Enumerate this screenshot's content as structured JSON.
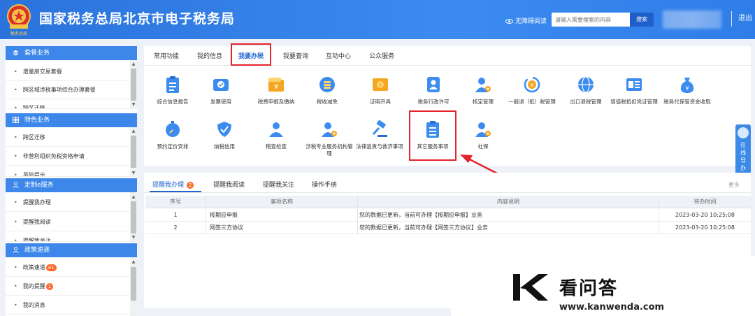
{
  "colors": {
    "header_blue": "#2f7de8",
    "accent": "#1e63d0",
    "highlight_red": "#e3242b",
    "badge_orange": "#ff6a2c"
  },
  "header": {
    "emblem_caption": "税务总局",
    "title": "国家税务总局北京市电子税务局",
    "accessibility_label": "无障碍阅读",
    "search_placeholder": "请输入需要搜索的内容",
    "search_button": "搜索",
    "logout_label": "退出"
  },
  "sidebar": {
    "groups": [
      {
        "title": "套餐业务",
        "icon": "layers-icon",
        "items": [
          "增量房交易套餐",
          "跨区域涉税事项综合办理套餐",
          "跨区迁移"
        ]
      },
      {
        "title": "特色业务",
        "icon": "grid-icon",
        "items": [
          "跨区迁移",
          "非营利组织免税资格申请",
          "风险提示"
        ]
      },
      {
        "title": "定制e服务",
        "icon": "user-icon",
        "items": [
          "提醒我办理",
          "提醒我阅读",
          "提醒我关注"
        ]
      },
      {
        "title": "政策速递",
        "icon": "user-icon",
        "items": [
          {
            "label": "政策速递",
            "badge": "41"
          },
          {
            "label": "我的提醒",
            "badge": "1"
          },
          {
            "label": "我的消息",
            "badge": ""
          }
        ]
      }
    ]
  },
  "main": {
    "tabs": [
      "常用功能",
      "我的信息",
      "我要办税",
      "我要查询",
      "互动中心",
      "公众服务"
    ],
    "active_tab": "我要办税",
    "services_row1": [
      {
        "label": "综合信息报告",
        "icon": "clipboard-icon"
      },
      {
        "label": "发票使用",
        "icon": "ticket-icon"
      },
      {
        "label": "税费申报及缴纳",
        "icon": "wallet-icon"
      },
      {
        "label": "税收减免",
        "icon": "coin-stack-icon"
      },
      {
        "label": "证明开具",
        "icon": "certificate-icon"
      },
      {
        "label": "税务行政许可",
        "icon": "id-card-icon"
      },
      {
        "label": "核定管理",
        "icon": "person-gear-icon"
      },
      {
        "label": "一般退（抵）税管理",
        "icon": "refund-cycle-icon"
      },
      {
        "label": "出口退税管理",
        "icon": "globe-icon"
      },
      {
        "label": "增值税抵扣凭证管理",
        "icon": "invoice-icon"
      },
      {
        "label": "税务代保管资金收取",
        "icon": "money-bag-icon"
      }
    ],
    "services_row2": [
      {
        "label": "预约定价安排",
        "icon": "stopwatch-icon"
      },
      {
        "label": "纳税信用",
        "icon": "shield-check-icon"
      },
      {
        "label": "稽查检查",
        "icon": "person-icon"
      },
      {
        "label": "涉税专业服务机构管理",
        "icon": "person-gear-icon"
      },
      {
        "label": "法律追责与救济事项",
        "icon": "gavel-icon"
      },
      {
        "label": "其它服务事项",
        "icon": "clipboard-list-icon"
      },
      {
        "label": "社保",
        "icon": "person-gear-icon"
      }
    ]
  },
  "live_chat": {
    "label": "在线导办"
  },
  "lower": {
    "tabs": [
      {
        "label": "提醒我办理",
        "badge": "2"
      },
      {
        "label": "提醒我阅读",
        "badge": ""
      },
      {
        "label": "提醒我关注",
        "badge": ""
      },
      {
        "label": "操作手册",
        "badge": ""
      }
    ],
    "more_label": "更多",
    "table": {
      "columns": [
        "序号",
        "事项名称",
        "内容说明",
        "待办时间"
      ],
      "rows": [
        [
          "1",
          "按期应申报",
          "您的数据已更新，当前可办理【按期应申报】业务",
          "2023-03-20 10:25:08"
        ],
        [
          "2",
          "网签三方协议",
          "您的数据已更新，当前可办理【网签三方协议】业务",
          "2023-03-20 10:25:08"
        ]
      ]
    }
  },
  "watermark": {
    "brand": "看问答",
    "url": "www.kanwenda.com"
  }
}
